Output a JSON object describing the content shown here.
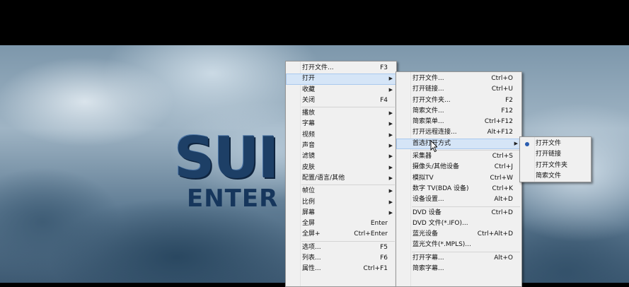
{
  "background": {
    "logo_main": "SUI",
    "logo_sub": "ENTER"
  },
  "menu_main": {
    "items": [
      {
        "label": "打开文件...",
        "shortcut": "F3"
      },
      {
        "label": "打开",
        "shortcut": "",
        "submenu": true
      },
      {
        "label": "收藏",
        "shortcut": "",
        "submenu": true
      },
      {
        "label": "关闭",
        "shortcut": "F4"
      },
      {
        "label": "播放",
        "shortcut": "",
        "submenu": true
      },
      {
        "label": "字幕",
        "shortcut": "",
        "submenu": true
      },
      {
        "label": "视频",
        "shortcut": "",
        "submenu": true
      },
      {
        "label": "声音",
        "shortcut": "",
        "submenu": true
      },
      {
        "label": "滤镜",
        "shortcut": "",
        "submenu": true
      },
      {
        "label": "皮肤",
        "shortcut": "",
        "submenu": true
      },
      {
        "label": "配置/语言/其他",
        "shortcut": "",
        "submenu": true
      },
      {
        "label": "帧位",
        "shortcut": "",
        "submenu": true
      },
      {
        "label": "比例",
        "shortcut": "",
        "submenu": true
      },
      {
        "label": "屏幕",
        "shortcut": "",
        "submenu": true
      },
      {
        "label": "全屏",
        "shortcut": "Enter"
      },
      {
        "label": "全屏+",
        "shortcut": "Ctrl+Enter"
      },
      {
        "label": "选项...",
        "shortcut": "F5"
      },
      {
        "label": "列表...",
        "shortcut": "F6"
      },
      {
        "label": "属性...",
        "shortcut": "Ctrl+F1"
      }
    ]
  },
  "menu_open": {
    "items": [
      {
        "label": "打开文件...",
        "shortcut": "Ctrl+O"
      },
      {
        "label": "打开链接...",
        "shortcut": "Ctrl+U"
      },
      {
        "label": "打开文件夹...",
        "shortcut": "F2"
      },
      {
        "label": "简索文件...",
        "shortcut": "F12"
      },
      {
        "label": "简索菜单...",
        "shortcut": "Ctrl+F12"
      },
      {
        "label": "打开远程连接...",
        "shortcut": "Alt+F12"
      },
      {
        "label": "首选打开方式",
        "shortcut": "",
        "submenu": true
      },
      {
        "label": "采集器",
        "shortcut": "Ctrl+S"
      },
      {
        "label": "摄像头/其他设备",
        "shortcut": "Ctrl+J"
      },
      {
        "label": "模拟TV",
        "shortcut": "Ctrl+W"
      },
      {
        "label": "数字 TV(BDA 设备)",
        "shortcut": "Ctrl+K"
      },
      {
        "label": "设备设置...",
        "shortcut": "Alt+D"
      },
      {
        "label": "DVD 设备",
        "shortcut": "Ctrl+D"
      },
      {
        "label": "DVD 文件(*.IFO)...",
        "shortcut": ""
      },
      {
        "label": "蓝光设备",
        "shortcut": "Ctrl+Alt+D"
      },
      {
        "label": "蓝光文件(*.MPLS)...",
        "shortcut": ""
      },
      {
        "label": "打开字幕...",
        "shortcut": "Alt+O"
      },
      {
        "label": "简索字幕...",
        "shortcut": ""
      }
    ]
  },
  "menu_preferred": {
    "items": [
      {
        "label": "打开文件",
        "selected": true
      },
      {
        "label": "打开链接",
        "selected": false
      },
      {
        "label": "打开文件夹",
        "selected": false
      },
      {
        "label": "简索文件",
        "selected": false
      }
    ]
  }
}
